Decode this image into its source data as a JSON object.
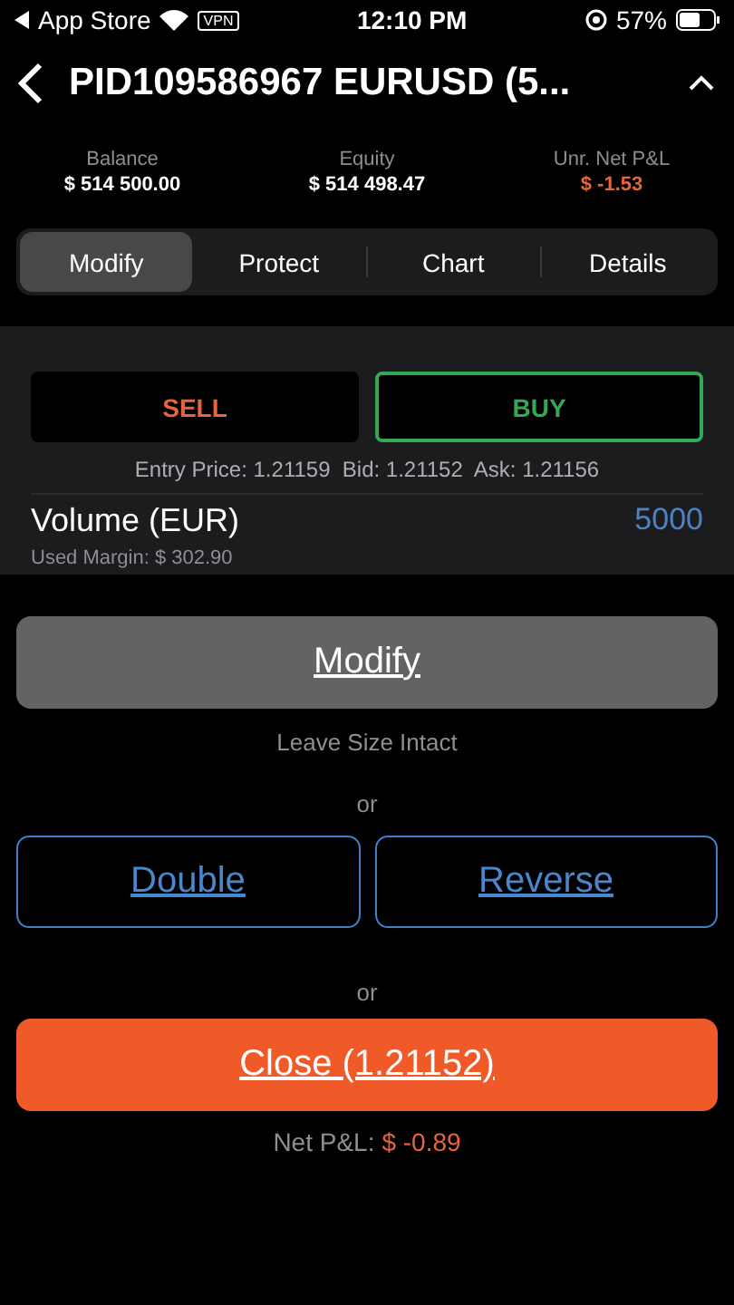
{
  "status_bar": {
    "back_app": "App Store",
    "vpn": "VPN",
    "time": "12:10 PM",
    "battery": "57%"
  },
  "header": {
    "title": "PID109586967 EURUSD (5..."
  },
  "stats": [
    {
      "label": "Balance",
      "value": "$ 514 500.00",
      "color": "#ffffff"
    },
    {
      "label": "Equity",
      "value": "$ 514 498.47",
      "color": "#ffffff"
    },
    {
      "label": "Unr. Net P&L",
      "value": "$ -1.53",
      "color": "#e8643a"
    }
  ],
  "tabs": [
    {
      "label": "Modify",
      "selected": true
    },
    {
      "label": "Protect",
      "selected": false
    },
    {
      "label": "Chart",
      "selected": false
    },
    {
      "label": "Details",
      "selected": false
    }
  ],
  "sides": [
    {
      "label": "SELL",
      "kind": "sell",
      "selected": false
    },
    {
      "label": "BUY",
      "kind": "buy",
      "selected": true
    }
  ],
  "prices": "Entry Price: 1.21159  Bid: 1.21152  Ask: 1.21156",
  "volume": {
    "label": "Volume (EUR)",
    "value": "5000",
    "margin": "Used Margin: $ 302.90"
  },
  "modify_button": "Modify",
  "modify_hint": "Leave Size Intact",
  "or_1": "or",
  "actions": [
    "Double",
    "Reverse"
  ],
  "or_2": "or",
  "close_button": "Close (1.21152)",
  "net_pnl": {
    "label": "Net P&L:",
    "value": "$ -0.89"
  }
}
